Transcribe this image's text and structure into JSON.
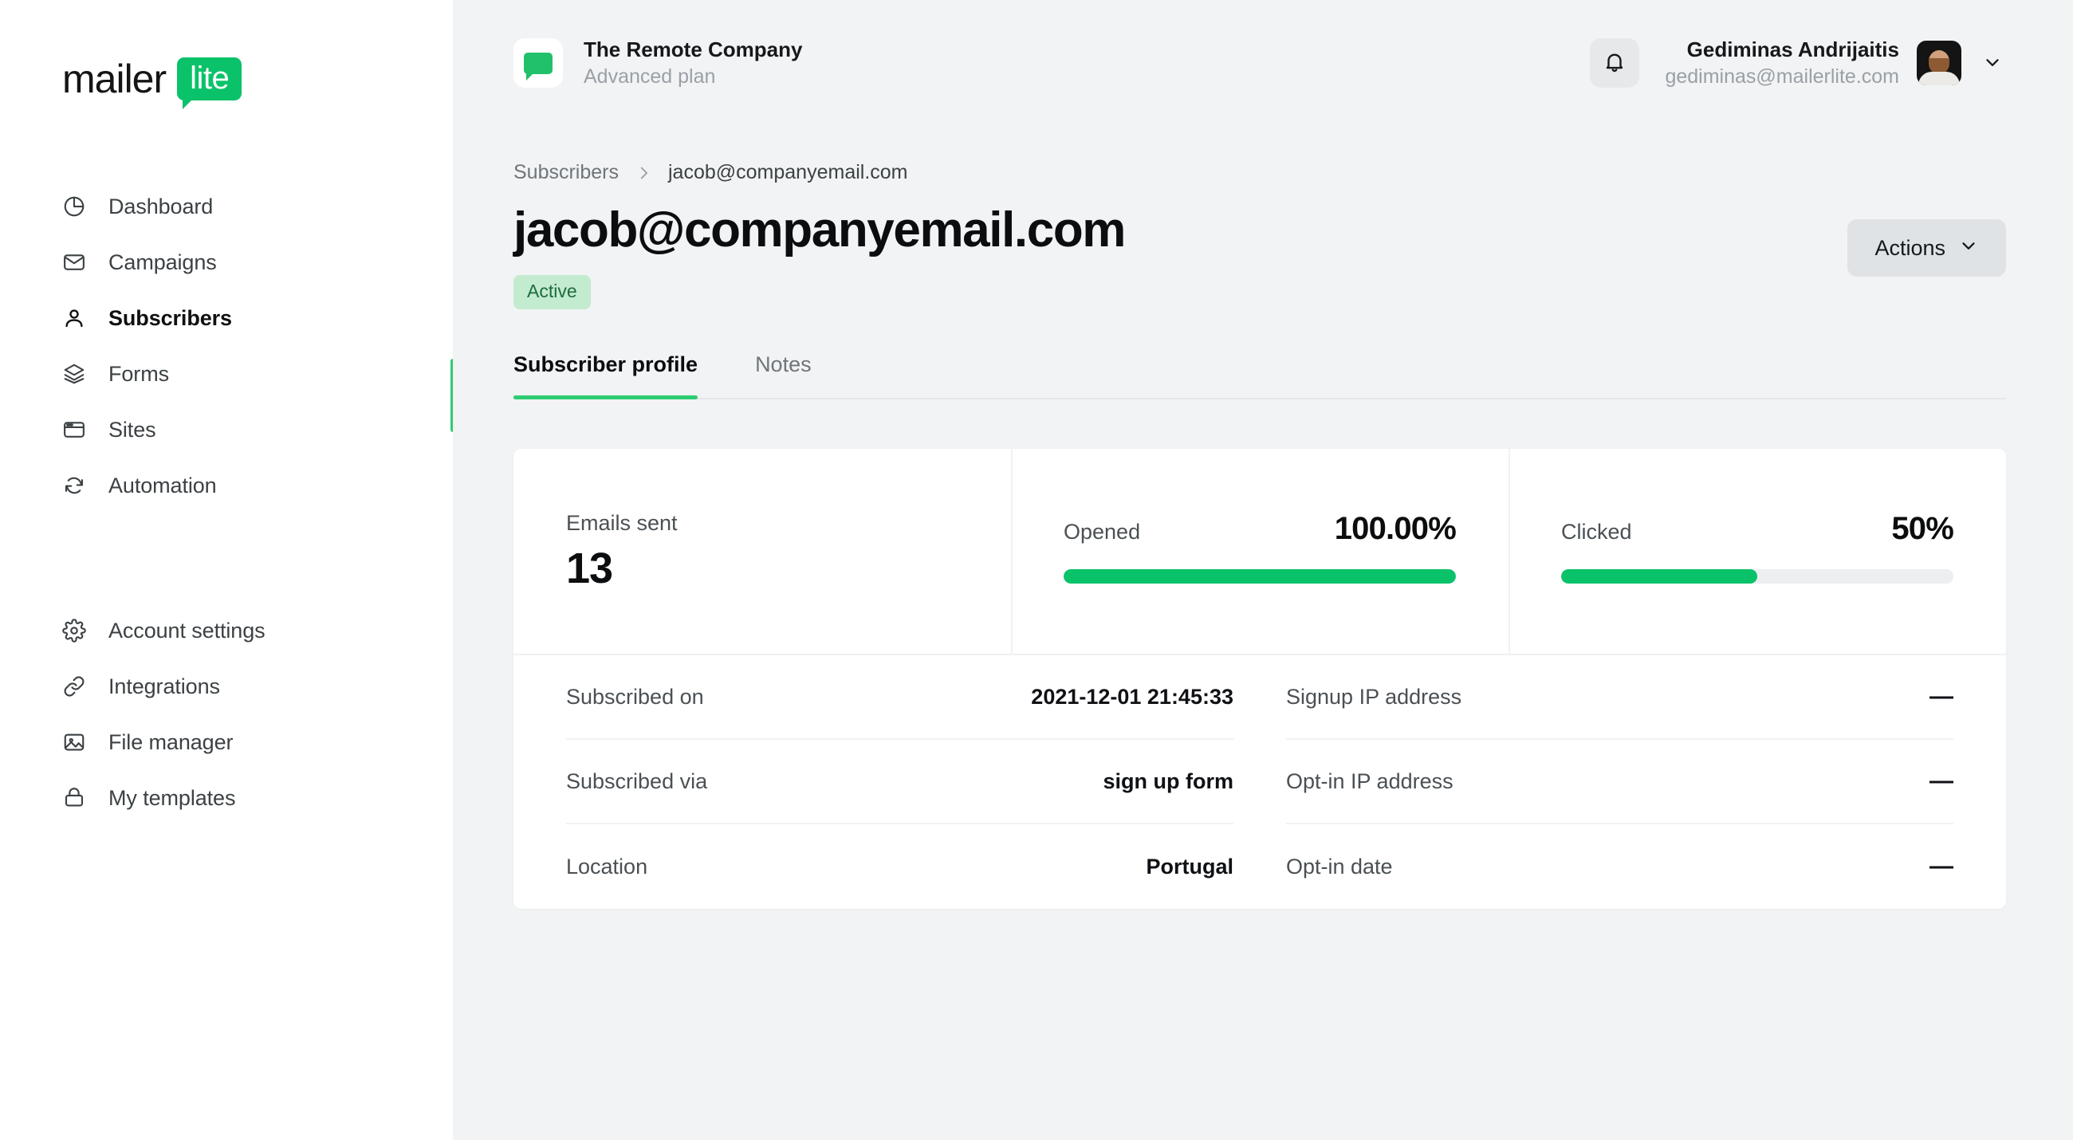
{
  "logo": {
    "text": "mailer",
    "badge": "lite"
  },
  "sidebar": {
    "groups": [
      {
        "items": [
          {
            "label": "Dashboard",
            "icon": "pie-chart-icon",
            "active": false
          },
          {
            "label": "Campaigns",
            "icon": "envelope-icon",
            "active": false
          },
          {
            "label": "Subscribers",
            "icon": "user-icon",
            "active": true
          },
          {
            "label": "Forms",
            "icon": "layers-icon",
            "active": false
          },
          {
            "label": "Sites",
            "icon": "browser-window-icon",
            "active": false
          },
          {
            "label": "Automation",
            "icon": "refresh-icon",
            "active": false
          }
        ]
      },
      {
        "items": [
          {
            "label": "Account settings",
            "icon": "gear-icon",
            "active": false
          },
          {
            "label": "Integrations",
            "icon": "link-icon",
            "active": false
          },
          {
            "label": "File manager",
            "icon": "image-icon",
            "active": false
          },
          {
            "label": "My templates",
            "icon": "archive-icon",
            "active": false
          }
        ]
      }
    ]
  },
  "topbar": {
    "brand_name": "The Remote Company",
    "brand_plan": "Advanced plan",
    "user_name": "Gediminas Andrijaitis",
    "user_email": "gediminas@mailerlite.com"
  },
  "breadcrumb": {
    "parent": "Subscribers",
    "current": "jacob@companyemail.com"
  },
  "page": {
    "title": "jacob@companyemail.com",
    "status_badge": "Active",
    "actions_label": "Actions"
  },
  "tabs": [
    {
      "label": "Subscriber profile",
      "active": true
    },
    {
      "label": "Notes",
      "active": false
    }
  ],
  "stats": [
    {
      "label": "Emails sent",
      "value": "13",
      "type": "number"
    },
    {
      "label": "Opened",
      "value": "100.00%",
      "type": "bar",
      "percent": 100
    },
    {
      "label": "Clicked",
      "value": "50%",
      "type": "bar",
      "percent": 50
    }
  ],
  "details": {
    "left": [
      {
        "label": "Subscribed on",
        "value": "2021-12-01 21:45:33"
      },
      {
        "label": "Subscribed via",
        "value": "sign up form"
      },
      {
        "label": "Location",
        "value": "Portugal"
      }
    ],
    "right": [
      {
        "label": "Signup IP address",
        "value": "—"
      },
      {
        "label": "Opt-in IP address",
        "value": "—"
      },
      {
        "label": "Opt-in date",
        "value": "—"
      }
    ]
  },
  "colors": {
    "brand_green": "#09c269",
    "accent_green": "#2ecc71",
    "badge_bg": "#c3ebd0",
    "badge_text": "#1d6c3d",
    "page_bg": "#f1f3f4"
  }
}
